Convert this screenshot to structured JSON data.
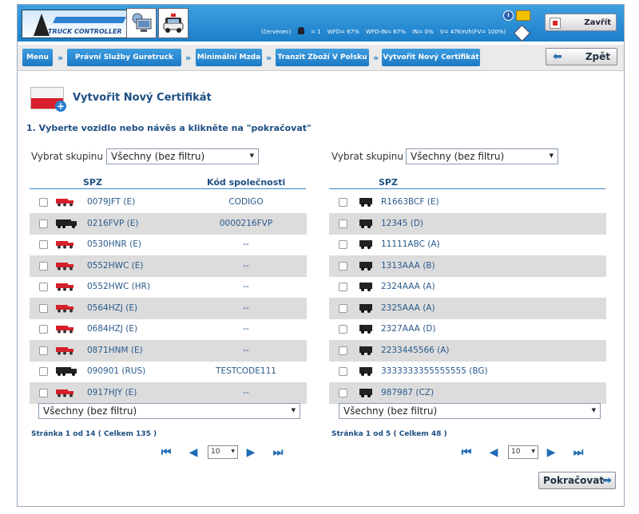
{
  "header": {
    "logo_text": "TRUCK CONTROLLER",
    "stats": {
      "month": "(červenec)",
      "drivers": "= 1",
      "wfd": "WFD= 67%",
      "wfd_in": "WFD-IN= 67%",
      "in": "IN= 0%",
      "speed": "V= 47Km/h(FV= 100%)"
    },
    "close_label": "Zavřít"
  },
  "breadcrumbs": [
    "Menu",
    "Právní Služby Guretruck",
    "Minimální Mzda",
    "Tranzit Zboží V Polsku",
    "Vytvořit Nový Certifikát"
  ],
  "breadcrumb_separator": "»",
  "back_label": "Zpět",
  "page_title": "Vytvořit Nový Certifikát",
  "step_text": "1. Vyberte vozidlo nebo návěs a klikněte na \"pokračovat\"",
  "left": {
    "group_label": "Vybrat skupinu",
    "group_value": "Všechny (bez filtru)",
    "col_spz": "SPZ",
    "col_code": "Kód společnosti",
    "rows": [
      {
        "spz": "0079JFT (E)",
        "code": "CODIGO",
        "vehicle": "trailer"
      },
      {
        "spz": "0216FVP (E)",
        "code": "0000216FVP",
        "vehicle": "truck"
      },
      {
        "spz": "0530HNR (E)",
        "code": "--",
        "vehicle": "trailer"
      },
      {
        "spz": "0552HWC (E)",
        "code": "--",
        "vehicle": "trailer"
      },
      {
        "spz": "0552HWC (HR)",
        "code": "--",
        "vehicle": "trailer"
      },
      {
        "spz": "0564HZJ (E)",
        "code": "--",
        "vehicle": "trailer"
      },
      {
        "spz": "0684HZJ (E)",
        "code": "--",
        "vehicle": "trailer"
      },
      {
        "spz": "0871HNM (E)",
        "code": "--",
        "vehicle": "trailer"
      },
      {
        "spz": "090901 (RUS)",
        "code": "TESTCODE111",
        "vehicle": "truck"
      },
      {
        "spz": "0917HJY (E)",
        "code": "--",
        "vehicle": "trailer"
      }
    ],
    "bottom_filter": "Všechny (bez filtru)",
    "page_info": "Stránka 1   od   14   ( Celkem 135 )",
    "page_size": "10"
  },
  "right": {
    "group_label": "Vybrat skupinu",
    "group_value": "Všechny (bez filtru)",
    "col_spz": "SPZ",
    "rows": [
      {
        "spz": "R1663BCF (E)"
      },
      {
        "spz": "12345 (D)"
      },
      {
        "spz": "11111ABC (A)"
      },
      {
        "spz": "1313AAA (B)"
      },
      {
        "spz": "2324AAA (A)"
      },
      {
        "spz": "2325AAA (A)"
      },
      {
        "spz": "2327AAA (D)"
      },
      {
        "spz": "2233445566 (A)"
      },
      {
        "spz": "3333333355555555 (BG)"
      },
      {
        "spz": "987987 (CZ)"
      }
    ],
    "bottom_filter": "Všechny (bez filtru)",
    "page_info": "Stránka 1   od   5   ( Celkem 48 )",
    "page_size": "10"
  },
  "continue_label": "Pokračovat",
  "colors": {
    "primary": "#1c7ac4",
    "row_alt": "#dcdcdc",
    "link_text": "#2a5a8c",
    "trailer_red": "#d7202b"
  }
}
